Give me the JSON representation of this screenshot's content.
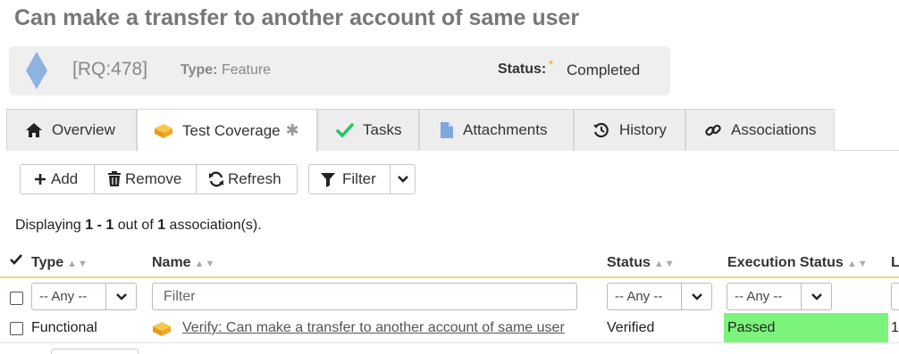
{
  "page": {
    "title": "Can make a transfer to another account of same user"
  },
  "requirement": {
    "id": "[RQ:478]",
    "type_label": "Type:",
    "type_value": "Feature",
    "status_label": "Status:",
    "status_star": "*",
    "status_value": "Completed"
  },
  "tabs": [
    {
      "label": "Overview",
      "icon": "home-icon"
    },
    {
      "label": "Test Coverage",
      "icon": "test-case-icon",
      "suffix": "✱",
      "active": true
    },
    {
      "label": "Tasks",
      "icon": "checkmark-icon"
    },
    {
      "label": "Attachments",
      "icon": "document-icon"
    },
    {
      "label": "History",
      "icon": "history-icon"
    },
    {
      "label": "Associations",
      "icon": "link-icon"
    }
  ],
  "toolbar": {
    "add_label": "Add",
    "remove_label": "Remove",
    "refresh_label": "Refresh",
    "filter_label": "Filter"
  },
  "display": {
    "prefix": "Displaying ",
    "range": "1 - 1",
    "middle": " out of ",
    "total": "1",
    "suffix": " association(s)."
  },
  "grid": {
    "columns": [
      "Type",
      "Name",
      "Status",
      "Execution Status",
      "L"
    ],
    "sort_glyph": "▲▼",
    "filters": {
      "type": "-- Any --",
      "name_placeholder": "Filter",
      "status": "-- Any --",
      "execution_status": "-- Any --"
    },
    "rows": [
      {
        "type": "Functional",
        "name": "Verify: Can make a transfer to another account of same user",
        "status": "Verified",
        "execution_status": "Passed",
        "last": "1"
      }
    ]
  },
  "colors": {
    "passed": "#7cf47c",
    "accent_star": "#f5a623",
    "header_underline": "#f3d57a",
    "diamond": "#8fb3e0"
  }
}
